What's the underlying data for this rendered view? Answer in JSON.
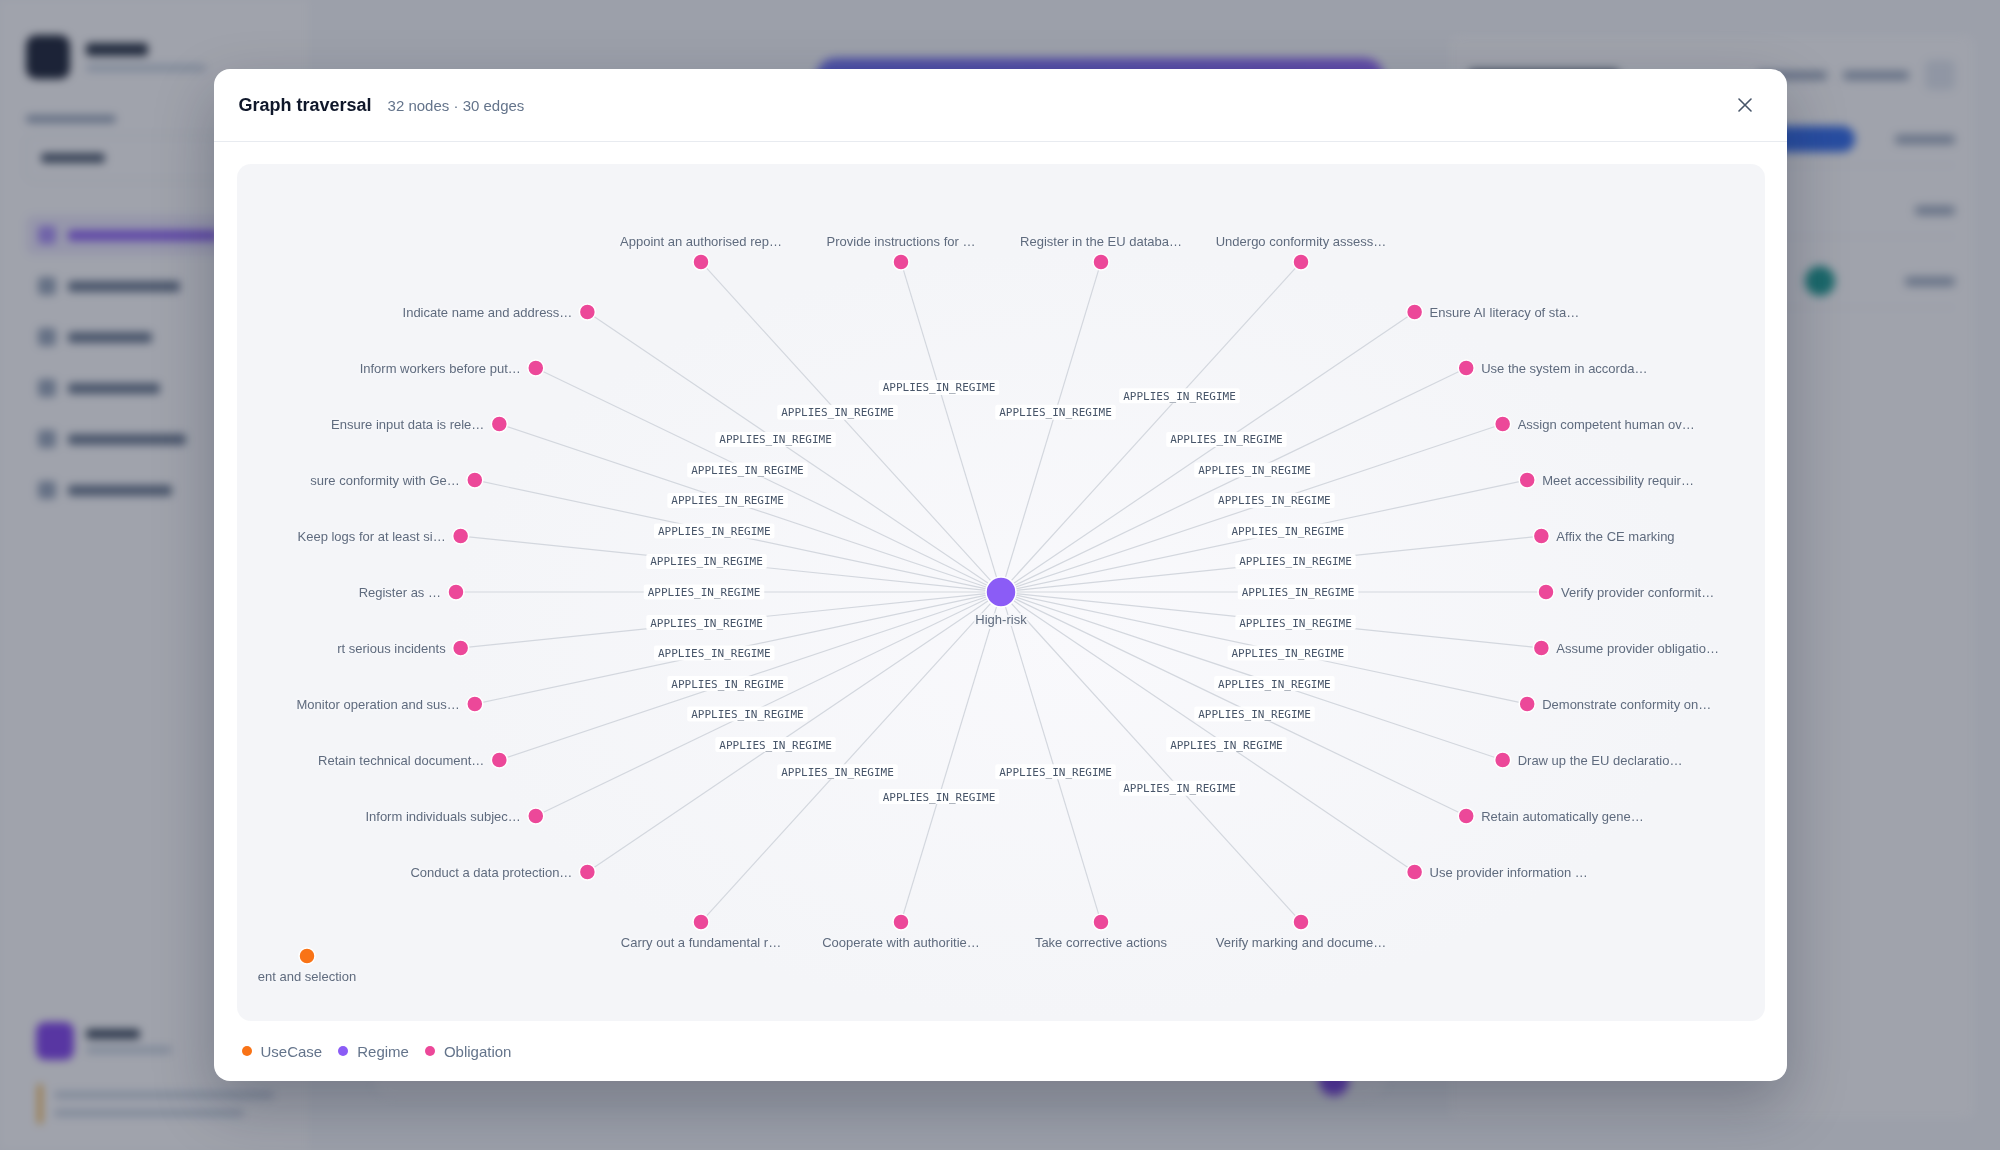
{
  "dialog": {
    "title": "Graph traversal",
    "summary": "32 nodes · 30 edges"
  },
  "graph": {
    "nodes": [
      {
        "kind": "regime",
        "label": "High-risk",
        "children": [
          {
            "kind": "obligation",
            "label": "Appoint an authorised rep…",
            "edge_label": "APPLIES_IN_REGIME"
          },
          {
            "kind": "obligation",
            "label": "Provide instructions for …",
            "edge_label": "APPLIES_IN_REGIME"
          },
          {
            "kind": "obligation",
            "label": "Register in the EU databa…",
            "edge_label": "APPLIES_IN_REGIME"
          },
          {
            "kind": "obligation",
            "label": "Undergo conformity assess…",
            "edge_label": "APPLIES_IN_REGIME"
          },
          {
            "kind": "obligation",
            "label": "Indicate name and address…",
            "edge_label": "APPLIES_IN_REGIME"
          },
          {
            "kind": "obligation",
            "label": "Ensure AI literacy of sta…",
            "edge_label": "APPLIES_IN_REGIME"
          },
          {
            "kind": "obligation",
            "label": "Inform workers before put…",
            "edge_label": "APPLIES_IN_REGIME"
          },
          {
            "kind": "obligation",
            "label": "Use the system in accorda…",
            "edge_label": "APPLIES_IN_REGIME"
          },
          {
            "kind": "obligation",
            "label": "Ensure input data is rele…",
            "edge_label": "APPLIES_IN_REGIME"
          },
          {
            "kind": "obligation",
            "label": "Assign competent human ov…",
            "edge_label": "APPLIES_IN_REGIME"
          },
          {
            "kind": "obligation",
            "label": "sure conformity with Ge…",
            "edge_label": "APPLIES_IN_REGIME"
          },
          {
            "kind": "obligation",
            "label": "Meet accessibility requir…",
            "edge_label": "APPLIES_IN_REGIME"
          },
          {
            "kind": "obligation",
            "label": "Keep logs for at least si…",
            "edge_label": "APPLIES_IN_REGIME"
          },
          {
            "kind": "obligation",
            "label": "Affix the CE marking",
            "edge_label": "APPLIES_IN_REGIME"
          },
          {
            "kind": "obligation",
            "label": "Register as …",
            "edge_label": "APPLIES_IN_REGIME"
          },
          {
            "kind": "obligation",
            "label": "Verify provider conformit…",
            "edge_label": "APPLIES_IN_REGIME"
          },
          {
            "kind": "obligation",
            "label": "rt serious incidents",
            "edge_label": "APPLIES_IN_REGIME"
          },
          {
            "kind": "obligation",
            "label": "Assume provider obligatio…",
            "edge_label": "APPLIES_IN_REGIME"
          },
          {
            "kind": "obligation",
            "label": "Monitor operation and sus…",
            "edge_label": "APPLIES_IN_REGIME"
          },
          {
            "kind": "obligation",
            "label": "Demonstrate conformity on…",
            "edge_label": "APPLIES_IN_REGIME"
          },
          {
            "kind": "obligation",
            "label": "Retain technical document…",
            "edge_label": "APPLIES_IN_REGIME"
          },
          {
            "kind": "obligation",
            "label": "Draw up the EU declaratio…",
            "edge_label": "APPLIES_IN_REGIME"
          },
          {
            "kind": "obligation",
            "label": "Inform individuals subjec…",
            "edge_label": "APPLIES_IN_REGIME"
          },
          {
            "kind": "obligation",
            "label": "Retain automatically gene…",
            "edge_label": "APPLIES_IN_REGIME"
          },
          {
            "kind": "obligation",
            "label": "Conduct a data protection…",
            "edge_label": "APPLIES_IN_REGIME"
          },
          {
            "kind": "obligation",
            "label": "Use provider information …",
            "edge_label": "APPLIES_IN_REGIME"
          },
          {
            "kind": "obligation",
            "label": "Carry out a fundamental r…",
            "edge_label": "APPLIES_IN_REGIME"
          },
          {
            "kind": "obligation",
            "label": "Cooperate with authoritie…",
            "edge_label": "APPLIES_IN_REGIME"
          },
          {
            "kind": "obligation",
            "label": "Take corrective actions",
            "edge_label": "APPLIES_IN_REGIME"
          },
          {
            "kind": "obligation",
            "label": "Verify marking and docume…",
            "edge_label": "APPLIES_IN_REGIME"
          }
        ]
      },
      {
        "kind": "usecase",
        "label": "ent and selection"
      }
    ]
  },
  "legend": [
    {
      "kind": "usecase",
      "label": "UseCase",
      "color": "#f97316"
    },
    {
      "kind": "regime",
      "label": "Regime",
      "color": "#8b5cf6"
    },
    {
      "kind": "obligation",
      "label": "Obligation",
      "color": "#ec4899"
    }
  ]
}
